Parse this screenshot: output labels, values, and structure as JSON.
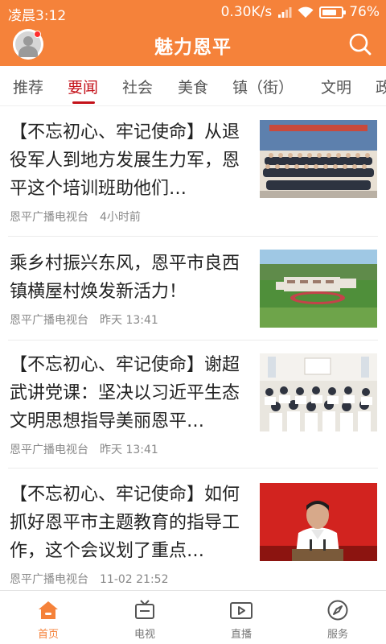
{
  "status_bar": {
    "time": "凌晨3:12",
    "net_speed": "0.30K/s",
    "battery": "76%",
    "battery_level": 0.76
  },
  "header": {
    "title": "魅力恩平",
    "notification_dot": true
  },
  "tabs": [
    {
      "label": "推荐",
      "active": false
    },
    {
      "label": "要闻",
      "active": true
    },
    {
      "label": "社会",
      "active": false
    },
    {
      "label": "美食",
      "active": false
    },
    {
      "label": "镇（街）",
      "active": false
    },
    {
      "label": "文明",
      "active": false
    },
    {
      "label": "政",
      "active": false
    }
  ],
  "news": [
    {
      "title": "【不忘初心、牢记使命】从退役军人到地方发展生力军，恩平这个培训班助他们…",
      "source": "恩平广播电视台",
      "time": "4小时前"
    },
    {
      "title": "乘乡村振兴东风，恩平市良西镇横屋村焕发新活力！",
      "source": "恩平广播电视台",
      "time": "昨天 13:41"
    },
    {
      "title": "【不忘初心、牢记使命】谢超武讲党课：坚决以习近平生态文明思想指导美丽恩平…",
      "source": "恩平广播电视台",
      "time": "昨天 13:41"
    },
    {
      "title": "【不忘初心、牢记使命】如何抓好恩平市主题教育的指导工作，这个会议划了重点…",
      "source": "恩平广播电视台",
      "time": "11-02 21:52"
    }
  ],
  "bottom_nav": [
    {
      "label": "首页",
      "icon": "home-icon",
      "active": true
    },
    {
      "label": "电视",
      "icon": "tv-icon",
      "active": false
    },
    {
      "label": "直播",
      "icon": "live-icon",
      "active": false
    },
    {
      "label": "服务",
      "icon": "compass-icon",
      "active": false
    }
  ],
  "colors": {
    "brand": "#f5823a",
    "active_tab": "#c4121a"
  }
}
